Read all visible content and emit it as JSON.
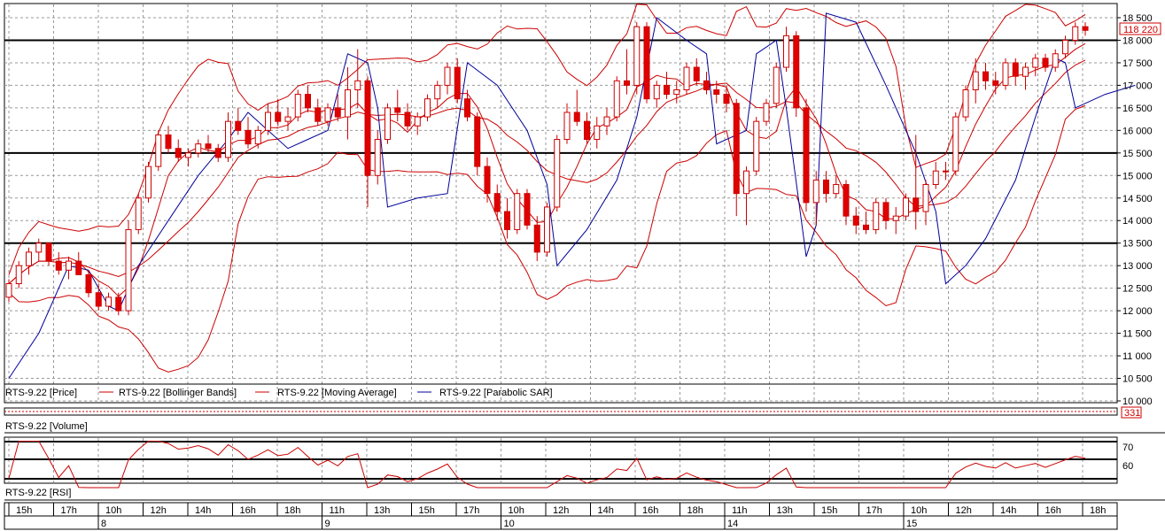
{
  "window": {
    "title": ""
  },
  "legends": {
    "price": {
      "items": [
        {
          "label": "RTS-9.22 [Price]",
          "color": ""
        },
        {
          "label": "RTS-9.22 [Bollinger Bands]",
          "color": "#cc0000"
        },
        {
          "label": "RTS-9.22 [Moving Average]",
          "color": "#cc0000"
        },
        {
          "label": "RTS-9.22 [Parabolic SAR]",
          "color": "#000099"
        }
      ]
    },
    "volume": "RTS-9.22 [Volume]",
    "rsi": "RTS-9.22 [RSI]"
  },
  "volume_value": "331",
  "last_price_label": "118 220",
  "chart_data": {
    "type": "candlestick",
    "ylim": [
      110000,
      18500
    ],
    "yticks": [
      "18 500",
      "18 000",
      "17 500",
      "17 000",
      "16 500",
      "16 000",
      "15 500",
      "15 000",
      "14 500",
      "14 000",
      "13 500",
      "13 000",
      "12 500",
      "12 000",
      "11 500",
      "11 000",
      "10 500",
      "10 000"
    ],
    "last_price": 118220,
    "horizontal_lines": [
      118000,
      115500,
      113500
    ],
    "candles": [
      [
        112300,
        112700,
        112200,
        112600
      ],
      [
        112600,
        113100,
        112500,
        113000
      ],
      [
        113000,
        113400,
        112800,
        113300
      ],
      [
        113300,
        113600,
        113100,
        113500
      ],
      [
        113500,
        113500,
        113000,
        113100
      ],
      [
        113100,
        113300,
        112800,
        112900
      ],
      [
        112900,
        113200,
        112700,
        113100
      ],
      [
        113100,
        113300,
        112800,
        112800
      ],
      [
        112800,
        112900,
        112300,
        112400
      ],
      [
        112400,
        112600,
        112000,
        112100
      ],
      [
        112100,
        112400,
        112000,
        112300
      ],
      [
        112300,
        112400,
        111900,
        112000
      ],
      [
        112000,
        114000,
        111900,
        113800
      ],
      [
        113800,
        114600,
        113700,
        114500
      ],
      [
        114500,
        115300,
        114400,
        115200
      ],
      [
        115200,
        116000,
        115100,
        115900
      ],
      [
        115900,
        116100,
        115500,
        115600
      ],
      [
        115600,
        115800,
        115300,
        115400
      ],
      [
        115400,
        115600,
        115200,
        115500
      ],
      [
        115500,
        115800,
        115400,
        115700
      ],
      [
        115700,
        115900,
        115500,
        115600
      ],
      [
        115600,
        115700,
        115300,
        115400
      ],
      [
        115400,
        116400,
        115300,
        116200
      ],
      [
        116200,
        116500,
        115900,
        116000
      ],
      [
        116000,
        116300,
        115600,
        115700
      ],
      [
        115700,
        116100,
        115600,
        116000
      ],
      [
        116000,
        116600,
        115900,
        116400
      ],
      [
        116400,
        116700,
        116100,
        116200
      ],
      [
        116200,
        116500,
        116000,
        116300
      ],
      [
        116300,
        116900,
        116200,
        116800
      ],
      [
        116800,
        117000,
        116400,
        116500
      ],
      [
        116500,
        116700,
        116100,
        116200
      ],
      [
        116200,
        116600,
        116100,
        116500
      ],
      [
        116500,
        116800,
        116200,
        116300
      ],
      [
        116300,
        117400,
        115800,
        116900
      ],
      [
        116900,
        117800,
        116500,
        117100
      ],
      [
        117100,
        117200,
        114300,
        115000
      ],
      [
        115000,
        116000,
        114800,
        115800
      ],
      [
        115800,
        116600,
        115700,
        116500
      ],
      [
        116500,
        116900,
        116200,
        116400
      ],
      [
        116400,
        116600,
        116000,
        116100
      ],
      [
        116100,
        116400,
        115900,
        116300
      ],
      [
        116300,
        116800,
        116200,
        116700
      ],
      [
        116700,
        117100,
        116500,
        117000
      ],
      [
        117000,
        117500,
        116800,
        117400
      ],
      [
        117400,
        117600,
        116600,
        116700
      ],
      [
        116700,
        116900,
        116200,
        116300
      ],
      [
        116300,
        116400,
        115000,
        115200
      ],
      [
        115200,
        115400,
        114400,
        114600
      ],
      [
        114600,
        114800,
        114000,
        114200
      ],
      [
        114200,
        114500,
        113600,
        113800
      ],
      [
        113800,
        114700,
        113700,
        114600
      ],
      [
        114600,
        114700,
        113800,
        113900
      ],
      [
        113900,
        114100,
        113100,
        113300
      ],
      [
        113300,
        114400,
        113200,
        114300
      ],
      [
        114300,
        115900,
        114200,
        115800
      ],
      [
        115800,
        116600,
        115700,
        116400
      ],
      [
        116400,
        116900,
        116100,
        116200
      ],
      [
        116200,
        116400,
        115700,
        115800
      ],
      [
        115800,
        116300,
        115600,
        116100
      ],
      [
        116100,
        116500,
        115900,
        116300
      ],
      [
        116300,
        117200,
        116200,
        117100
      ],
      [
        117100,
        117800,
        116800,
        117000
      ],
      [
        117000,
        118400,
        116800,
        118300
      ],
      [
        118300,
        118400,
        116600,
        116700
      ],
      [
        116700,
        117100,
        116500,
        117000
      ],
      [
        117000,
        117300,
        116700,
        116800
      ],
      [
        116800,
        117100,
        116600,
        116900
      ],
      [
        116900,
        117500,
        116800,
        117400
      ],
      [
        117400,
        117600,
        117000,
        117100
      ],
      [
        117100,
        117300,
        116800,
        116900
      ],
      [
        116900,
        117100,
        116600,
        116800
      ],
      [
        116800,
        117000,
        116400,
        116600
      ],
      [
        116600,
        116700,
        114100,
        114600
      ],
      [
        114600,
        115200,
        113900,
        115100
      ],
      [
        115100,
        116300,
        115000,
        116200
      ],
      [
        116200,
        116700,
        116100,
        116600
      ],
      [
        116600,
        117500,
        116500,
        117400
      ],
      [
        117400,
        118300,
        117300,
        118100
      ],
      [
        118100,
        118200,
        116300,
        116500
      ],
      [
        116500,
        116700,
        114200,
        114400
      ],
      [
        114400,
        115100,
        113900,
        114900
      ],
      [
        114900,
        115100,
        114400,
        114600
      ],
      [
        114600,
        115000,
        114500,
        114800
      ],
      [
        114800,
        114900,
        113900,
        114100
      ],
      [
        114100,
        114300,
        113700,
        113900
      ],
      [
        113900,
        114200,
        113700,
        113800
      ],
      [
        113800,
        114500,
        113700,
        114400
      ],
      [
        114400,
        114500,
        113800,
        114000
      ],
      [
        114000,
        114300,
        113700,
        114100
      ],
      [
        114100,
        114600,
        114000,
        114500
      ],
      [
        114500,
        115900,
        113800,
        114200
      ],
      [
        114200,
        114900,
        113900,
        114800
      ],
      [
        114800,
        115300,
        114700,
        115100
      ],
      [
        115100,
        115300,
        114900,
        115100
      ],
      [
        115100,
        116400,
        115000,
        116300
      ],
      [
        116300,
        117000,
        116200,
        116900
      ],
      [
        116900,
        117600,
        116600,
        117300
      ],
      [
        117300,
        117500,
        116900,
        117100
      ],
      [
        117100,
        117300,
        116800,
        117000
      ],
      [
        117000,
        117600,
        116900,
        117500
      ],
      [
        117500,
        117600,
        117000,
        117200
      ],
      [
        117200,
        117500,
        116900,
        117400
      ],
      [
        117400,
        117700,
        117200,
        117600
      ],
      [
        117600,
        117700,
        117300,
        117400
      ],
      [
        117400,
        117800,
        117300,
        117700
      ],
      [
        117700,
        118100,
        117600,
        118000
      ],
      [
        118000,
        118400,
        117900,
        118300
      ],
      [
        118300,
        118400,
        118100,
        118220
      ]
    ],
    "parabolic_sar": [
      [
        0,
        110500
      ],
      [
        3,
        111500
      ],
      [
        6,
        113000
      ],
      [
        8,
        112900
      ],
      [
        10,
        112100
      ],
      [
        11,
        112000
      ],
      [
        13,
        113000
      ],
      [
        16,
        114000
      ],
      [
        19,
        115000
      ],
      [
        22,
        115800
      ],
      [
        24,
        116400
      ],
      [
        28,
        115600
      ],
      [
        30,
        115800
      ],
      [
        32,
        116000
      ],
      [
        34,
        117700
      ],
      [
        36,
        117500
      ],
      [
        37,
        116500
      ],
      [
        38,
        114300
      ],
      [
        41,
        114500
      ],
      [
        44,
        114600
      ],
      [
        46,
        117500
      ],
      [
        49,
        117000
      ],
      [
        52,
        116000
      ],
      [
        54,
        114800
      ],
      [
        55,
        113000
      ],
      [
        58,
        113800
      ],
      [
        61,
        114900
      ],
      [
        63,
        116300
      ],
      [
        65,
        118500
      ],
      [
        68,
        118000
      ],
      [
        70,
        117700
      ],
      [
        71,
        115700
      ],
      [
        74,
        116000
      ],
      [
        75,
        117700
      ],
      [
        77,
        118000
      ],
      [
        78,
        116500
      ],
      [
        80,
        113200
      ],
      [
        81,
        113900
      ],
      [
        82,
        118600
      ],
      [
        85,
        118400
      ],
      [
        88,
        117000
      ],
      [
        91,
        115500
      ],
      [
        93,
        114200
      ],
      [
        94,
        112600
      ],
      [
        96,
        113000
      ],
      [
        98,
        113600
      ],
      [
        101,
        114900
      ],
      [
        103,
        116300
      ],
      [
        105,
        117600
      ],
      [
        106,
        117500
      ],
      [
        107,
        116500
      ],
      [
        110,
        116800
      ],
      [
        113,
        117000
      ]
    ],
    "time_labels": [
      "15h",
      "17h",
      "10h",
      "12h",
      "14h",
      "16h",
      "18h",
      "11h",
      "13h",
      "15h",
      "17h",
      "10h",
      "12h",
      "14h",
      "16h",
      "18h",
      "11h",
      "13h",
      "15h",
      "17h",
      "10h",
      "12h",
      "14h",
      "16h",
      "18h"
    ],
    "date_labels": [
      "8",
      "9",
      "10",
      "14",
      "15"
    ],
    "rsi": {
      "ticks": [
        "70",
        "60"
      ]
    }
  }
}
